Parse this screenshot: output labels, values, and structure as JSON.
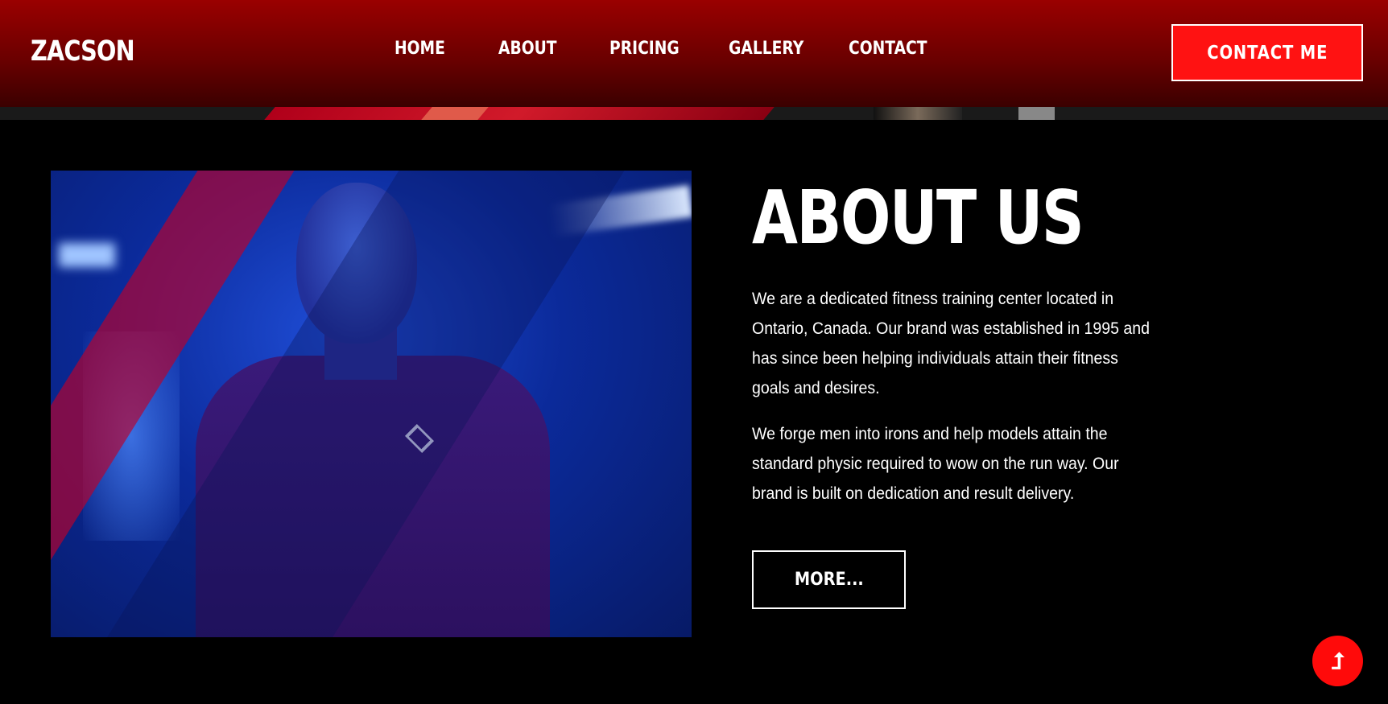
{
  "header": {
    "logo": "ZACSON",
    "nav": [
      {
        "label": "HOME"
      },
      {
        "label": "ABOUT"
      },
      {
        "label": "PRICING"
      },
      {
        "label": "GALLERY"
      },
      {
        "label": "CONTACT"
      }
    ],
    "cta_label": "CONTACT ME"
  },
  "about": {
    "title": "ABOUT US",
    "paragraphs": [
      "We are a dedicated fitness training center located in Ontario, Canada. Our brand was established in 1995 and has since been helping individuals attain their fitness goals and desires.",
      "We forge men into irons and help models attain the standard physic required to wow on the run way. Our brand is built on dedication and result delivery."
    ],
    "more_label": "MORE..."
  },
  "scroll_top": {
    "icon": "arrow-up-icon",
    "glyph": "⮥"
  },
  "colors": {
    "header_top": "#9a0000",
    "header_bottom": "#3a0000",
    "accent": "#ff1212",
    "background": "#000000",
    "text": "#ffffff"
  }
}
